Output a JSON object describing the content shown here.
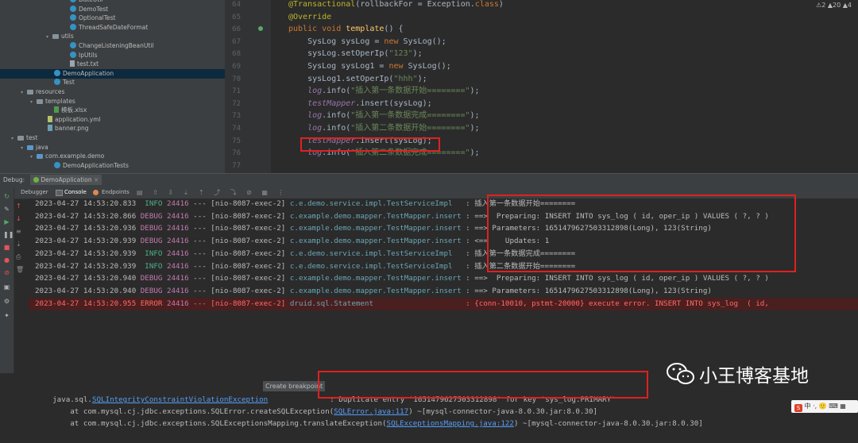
{
  "tree": [
    {
      "label": "DateUtil",
      "indent": 88,
      "icon": "class-icon"
    },
    {
      "label": "DemoTest",
      "indent": 88,
      "icon": "class-icon"
    },
    {
      "label": "OptionalTest",
      "indent": 88,
      "icon": "class-icon"
    },
    {
      "label": "ThreadSafeDateFormat",
      "indent": 88,
      "icon": "class-icon"
    },
    {
      "label": "utils",
      "indent": 68,
      "icon": "folder-icon",
      "arrow": "▾"
    },
    {
      "label": "ChangeListeningBeanUtil",
      "indent": 88,
      "icon": "class-icon"
    },
    {
      "label": "IpUtils",
      "indent": 88,
      "icon": "class-icon"
    },
    {
      "label": "test.txt",
      "indent": 88,
      "icon": "file-icon"
    },
    {
      "label": "DemoApplication",
      "indent": 68,
      "icon": "class-icon",
      "selected": true
    },
    {
      "label": "Test",
      "indent": 68,
      "icon": "class-icon"
    },
    {
      "label": "resources",
      "indent": 36,
      "icon": "folder-icon",
      "arrow": "▾"
    },
    {
      "label": "templates",
      "indent": 48,
      "icon": "folder-icon",
      "arrow": "▾"
    },
    {
      "label": "模板.xlsx",
      "indent": 68,
      "icon": "xlsx-icon"
    },
    {
      "label": "application.yml",
      "indent": 60,
      "icon": "yml-icon"
    },
    {
      "label": "banner.png",
      "indent": 60,
      "icon": "png-icon"
    },
    {
      "label": "test",
      "indent": 24,
      "icon": "folder-icon",
      "arrow": "▾"
    },
    {
      "label": "java",
      "indent": 36,
      "icon": "folder-icon",
      "arrow": "▾"
    },
    {
      "label": "com.example.demo",
      "indent": 48,
      "icon": "folder-icon",
      "arrow": "▾"
    },
    {
      "label": "DemoApplicationTests",
      "indent": 68,
      "icon": "class-icon"
    }
  ],
  "editor": {
    "inspections": "⚠2 ▲20 ▲4",
    "lines": [
      {
        "num": "64",
        "html": "<span class='ann'>@Transactional</span>(rollbackFor = Exception.<span class='kw'>class</span>)"
      },
      {
        "num": "65",
        "html": "<span class='ann'>@Override</span>"
      },
      {
        "num": "66",
        "html": "<span class='kw'>public void </span><span class='mth'>template</span>() {"
      },
      {
        "num": "67",
        "html": "    SysLog sysLog = <span class='kw'>new </span>SysLog();"
      },
      {
        "num": "68",
        "html": "    sysLog.setOperIp(<span class='str'>\"123\"</span>);"
      },
      {
        "num": "69",
        "html": "    SysLog sysLog1 = <span class='kw'>new </span>SysLog();"
      },
      {
        "num": "70",
        "html": "    sysLog1.setOperIp(<span class='str'>\"hhh\"</span>);"
      },
      {
        "num": "71",
        "html": "    <span class='fld'>log</span>.info(<span class='str'>\"插入第一条数据开始========\"</span>);"
      },
      {
        "num": "72",
        "html": "    <span class='fld'>testMapper</span>.insert(sysLog);"
      },
      {
        "num": "73",
        "html": "    <span class='fld'>log</span>.info(<span class='str'>\"插入第一条数据完成========\"</span>);"
      },
      {
        "num": "74",
        "html": "    <span class='fld'>log</span>.info(<span class='str'>\"插入第二条数据开始========\"</span>);"
      },
      {
        "num": "75",
        "html": "    <span class='fld'>testMapper</span>.insert(sysLog);"
      },
      {
        "num": "76",
        "html": "    <span class='fld'>log</span>.info(<span class='str'>\"插入第二条数据完成========\"</span>);"
      },
      {
        "num": "77",
        "html": ""
      }
    ]
  },
  "debug": {
    "label": "Debug:",
    "config": "DemoApplication",
    "tabs": [
      "Debugger",
      "Console",
      "Endpoints"
    ]
  },
  "console": [
    {
      "ts": "2023-04-27 14:53:20.833",
      "level": "INFO",
      "pid": "24416",
      "sep": "---",
      "thread": "[nio-8087-exec-2]",
      "cls": "c.e.demo.service.impl.TestServiceImpl",
      "msg": ": 插入第一条数据开始========"
    },
    {
      "ts": "2023-04-27 14:53:20.866",
      "level": "DEBUG",
      "pid": "24416",
      "sep": "---",
      "thread": "[nio-8087-exec-2]",
      "cls": "c.example.demo.mapper.TestMapper.insert",
      "msg": ": ==>  Preparing: INSERT INTO sys_log ( id, oper_ip ) VALUES ( ?, ? )"
    },
    {
      "ts": "2023-04-27 14:53:20.936",
      "level": "DEBUG",
      "pid": "24416",
      "sep": "---",
      "thread": "[nio-8087-exec-2]",
      "cls": "c.example.demo.mapper.TestMapper.insert",
      "msg": ": ==> Parameters: 1651479627503312898(Long), 123(String)"
    },
    {
      "ts": "2023-04-27 14:53:20.939",
      "level": "DEBUG",
      "pid": "24416",
      "sep": "---",
      "thread": "[nio-8087-exec-2]",
      "cls": "c.example.demo.mapper.TestMapper.insert",
      "msg": ": <==    Updates: 1"
    },
    {
      "ts": "2023-04-27 14:53:20.939",
      "level": "INFO",
      "pid": "24416",
      "sep": "---",
      "thread": "[nio-8087-exec-2]",
      "cls": "c.e.demo.service.impl.TestServiceImpl",
      "msg": ": 插入第一条数据完成========"
    },
    {
      "ts": "2023-04-27 14:53:20.939",
      "level": "INFO",
      "pid": "24416",
      "sep": "---",
      "thread": "[nio-8087-exec-2]",
      "cls": "c.e.demo.service.impl.TestServiceImpl",
      "msg": ": 插入第二条数据开始========"
    },
    {
      "ts": "2023-04-27 14:53:20.940",
      "level": "DEBUG",
      "pid": "24416",
      "sep": "---",
      "thread": "[nio-8087-exec-2]",
      "cls": "c.example.demo.mapper.TestMapper.insert",
      "msg": ": ==>  Preparing: INSERT INTO sys_log ( id, oper_ip ) VALUES ( ?, ? )"
    },
    {
      "ts": "2023-04-27 14:53:20.940",
      "level": "DEBUG",
      "pid": "24416",
      "sep": "---",
      "thread": "[nio-8087-exec-2]",
      "cls": "c.example.demo.mapper.TestMapper.insert",
      "msg": ": ==> Parameters: 1651479627503312898(Long), 123(String)"
    },
    {
      "ts": "2023-04-27 14:53:20.955",
      "level": "ERROR",
      "pid": "24416",
      "sep": "---",
      "thread": "[nio-8087-exec-2]",
      "cls": "druid.sql.Statement",
      "msg": ": {conn-10010, pstmt-20000} execute error. INSERT INTO sys_log  ( id,"
    }
  ],
  "exception": {
    "prefix": "java.sql.",
    "exc_class": "SQLIntegrityConstraintViolationException",
    "tooltip": "Create breakpoint",
    "message": ": Duplicate entry '1651479627503312898' for key 'sys_log.PRIMARY'",
    "trace1_pre": "    at com.mysql.cj.jdbc.exceptions.SQLError.createSQLException(",
    "trace1_link": "SQLError.java:117",
    "trace1_post": ") ~[mysql-connector-java-8.0.30.jar:8.0.30]",
    "trace2_pre": "    at com.mysql.cj.jdbc.exceptions.SQLExceptionsMapping.translateException(",
    "trace2_link": "SQLExceptionsMapping.java:122",
    "trace2_post": ") ~[mysql-connector-java-8.0.30.jar:8.0.30]"
  },
  "watermark": "小王博客基地",
  "ime": "中 ·, 🙂 ⌨ ▦"
}
